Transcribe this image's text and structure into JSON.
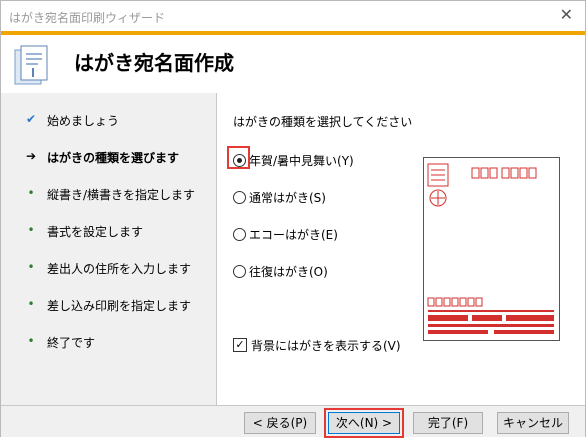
{
  "window": {
    "title": "はがき宛名面印刷ウィザード",
    "close_glyph": "✕"
  },
  "header": {
    "title": "はがき宛名面作成"
  },
  "steps": [
    {
      "label": "始めましょう",
      "mark": "✔"
    },
    {
      "label": "はがきの種類を選びます",
      "mark": "➔"
    },
    {
      "label": "縦書き/横書きを指定します",
      "mark": "•"
    },
    {
      "label": "書式を設定します",
      "mark": "•"
    },
    {
      "label": "差出人の住所を入力します",
      "mark": "•"
    },
    {
      "label": "差し込み印刷を指定します",
      "mark": "•"
    },
    {
      "label": "終了です",
      "mark": "•"
    }
  ],
  "main": {
    "prompt": "はがきの種類を選択してください",
    "options": [
      {
        "label": "年賀/暑中見舞い(Y)",
        "selected": true
      },
      {
        "label": "通常はがき(S)",
        "selected": false
      },
      {
        "label": "エコーはがき(E)",
        "selected": false
      },
      {
        "label": "往復はがき(O)",
        "selected": false
      }
    ],
    "show_background": {
      "label": "背景にはがきを表示する(V)",
      "checked": true,
      "glyph": "✓"
    }
  },
  "buttons": {
    "back": "< 戻る(P)",
    "next": "次へ(N) >",
    "finish": "完了(F)",
    "cancel": "キャンセル"
  },
  "colors": {
    "accent": "#f0a500",
    "highlight": "#e53935",
    "stamp": "#d32f2f"
  }
}
